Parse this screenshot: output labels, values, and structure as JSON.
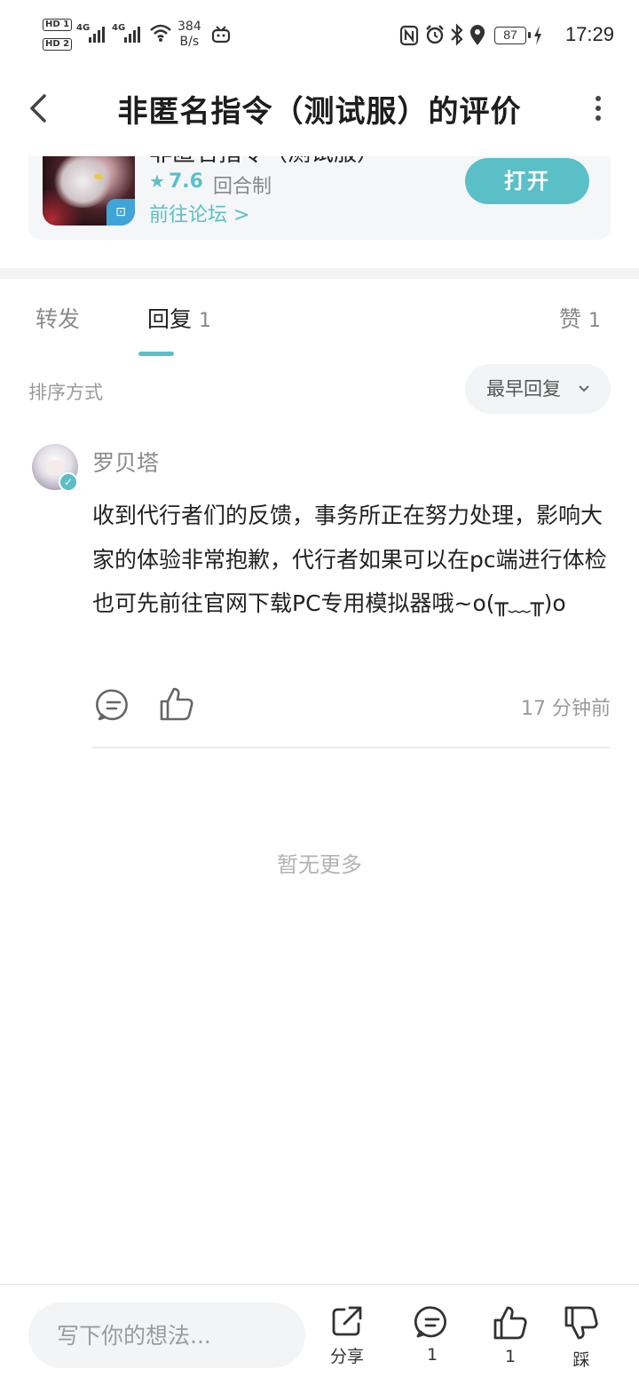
{
  "status_bar": {
    "hd1": "HD 1",
    "hd2": "HD 2",
    "net1": "4G",
    "net2": "4G",
    "speed_value": "384",
    "speed_unit": "B/s",
    "battery": "87",
    "time": "17:29"
  },
  "header": {
    "title": "非匿名指令（测试服）的评价"
  },
  "app_card": {
    "name": "非匿名指令（测试服）",
    "rating": "7.6",
    "genre": "回合制",
    "forum_link": "前往论坛 >",
    "open_button": "打开"
  },
  "tabs": [
    {
      "label": "转发",
      "count": ""
    },
    {
      "label": "回复",
      "count": "1"
    },
    {
      "label": "赞",
      "count": "1"
    }
  ],
  "sort": {
    "label": "排序方式",
    "selected": "最早回复",
    "chevron_icon": "chevron-down-icon"
  },
  "reply": {
    "author": "罗贝塔",
    "text": "收到代行者们的反馈，事务所正在努力处理，影响大家的体验非常抱歉，代行者如果可以在pc端进行体检也可先前往官网下载PC专用模拟器哦~o(╥﹏╥)o",
    "time": "17 分钟前"
  },
  "no_more": "暂无更多",
  "bottom_bar": {
    "input_placeholder": "写下你的想法...",
    "share_label": "分享",
    "comment_count": "1",
    "like_count": "1",
    "dislike_label": "踩"
  },
  "colors": {
    "accent": "#5bbfc7",
    "text_primary": "#222222",
    "text_secondary": "#8a8a8a"
  }
}
